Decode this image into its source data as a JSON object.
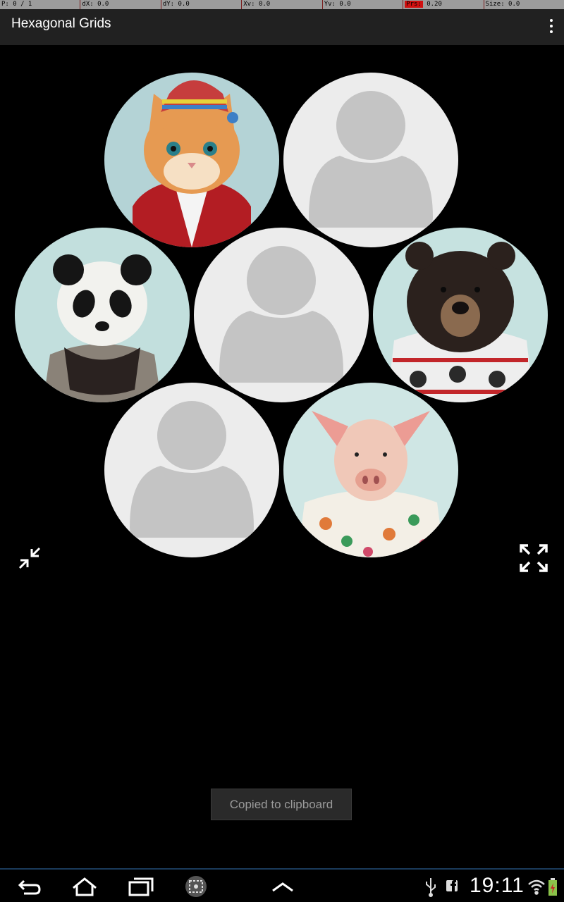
{
  "debug": {
    "p": "P: 0 / 1",
    "dx": "dX: 0.0",
    "dy": "dY: 0.0",
    "xv": "Xv: 0.0",
    "yv": "Yv: 0.0",
    "prs_label": "Prs:",
    "prs_value": " 0.20",
    "size": "Size: 0.0"
  },
  "actionbar": {
    "title": "Hexagonal Grids",
    "menu_icon": "overflow-menu-icon"
  },
  "grid": {
    "cells": [
      {
        "kind": "kitten",
        "icon": "kitten-avatar"
      },
      {
        "kind": "placeholder",
        "icon": "default-user-avatar"
      },
      {
        "kind": "panda",
        "icon": "panda-avatar"
      },
      {
        "kind": "placeholder",
        "icon": "default-user-avatar"
      },
      {
        "kind": "bear",
        "icon": "bear-avatar"
      },
      {
        "kind": "placeholder",
        "icon": "default-user-avatar"
      },
      {
        "kind": "pig",
        "icon": "pig-avatar"
      }
    ]
  },
  "controls": {
    "collapse_icon": "collapse-icon",
    "expand_icon": "expand-icon"
  },
  "toast": {
    "text": "Copied to clipboard"
  },
  "system_bar": {
    "time": "19:11",
    "icons": [
      "back-icon",
      "home-icon",
      "recent-apps-icon",
      "screenshot-icon",
      "up-chevron-icon",
      "usb-icon",
      "facebook-icon",
      "wifi-icon",
      "battery-icon"
    ]
  },
  "colors": {
    "background": "#000000",
    "actionbar": "#212121",
    "placeholder_bg": "#ececec",
    "placeholder_fg": "#c4c4c4"
  }
}
